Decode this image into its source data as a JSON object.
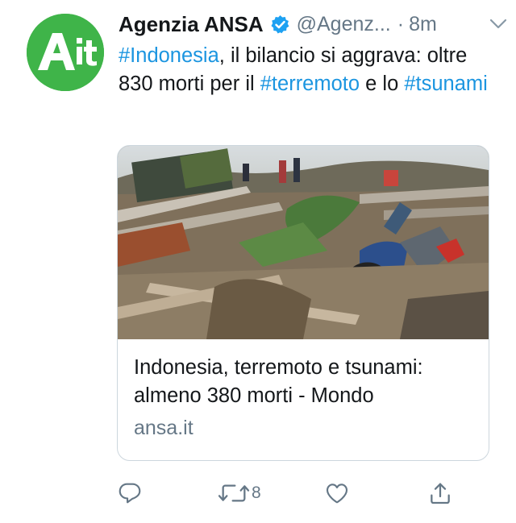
{
  "tweet": {
    "author_name": "Agenzia ANSA",
    "handle": "@Agenz...",
    "separator": "·",
    "time": "8m",
    "avatar_text": "Ait",
    "text_parts": [
      {
        "text": "#Indonesia",
        "hashtag": true
      },
      {
        "text": ", il bilancio si aggrava: oltre 830 morti per il ",
        "hashtag": false
      },
      {
        "text": "#terremoto",
        "hashtag": true
      },
      {
        "text": " e lo ",
        "hashtag": false
      },
      {
        "text": "#tsunami",
        "hashtag": true
      }
    ],
    "card": {
      "title": "Indonesia, terremoto e tsunami: almeno 380 morti - Mondo",
      "domain": "ansa.it"
    },
    "actions": {
      "retweet_count": "8"
    }
  },
  "colors": {
    "hashtag": "#1b95e0",
    "secondary_text": "#657786",
    "avatar_bg": "#3fb449",
    "verified": "#1da1f2"
  }
}
